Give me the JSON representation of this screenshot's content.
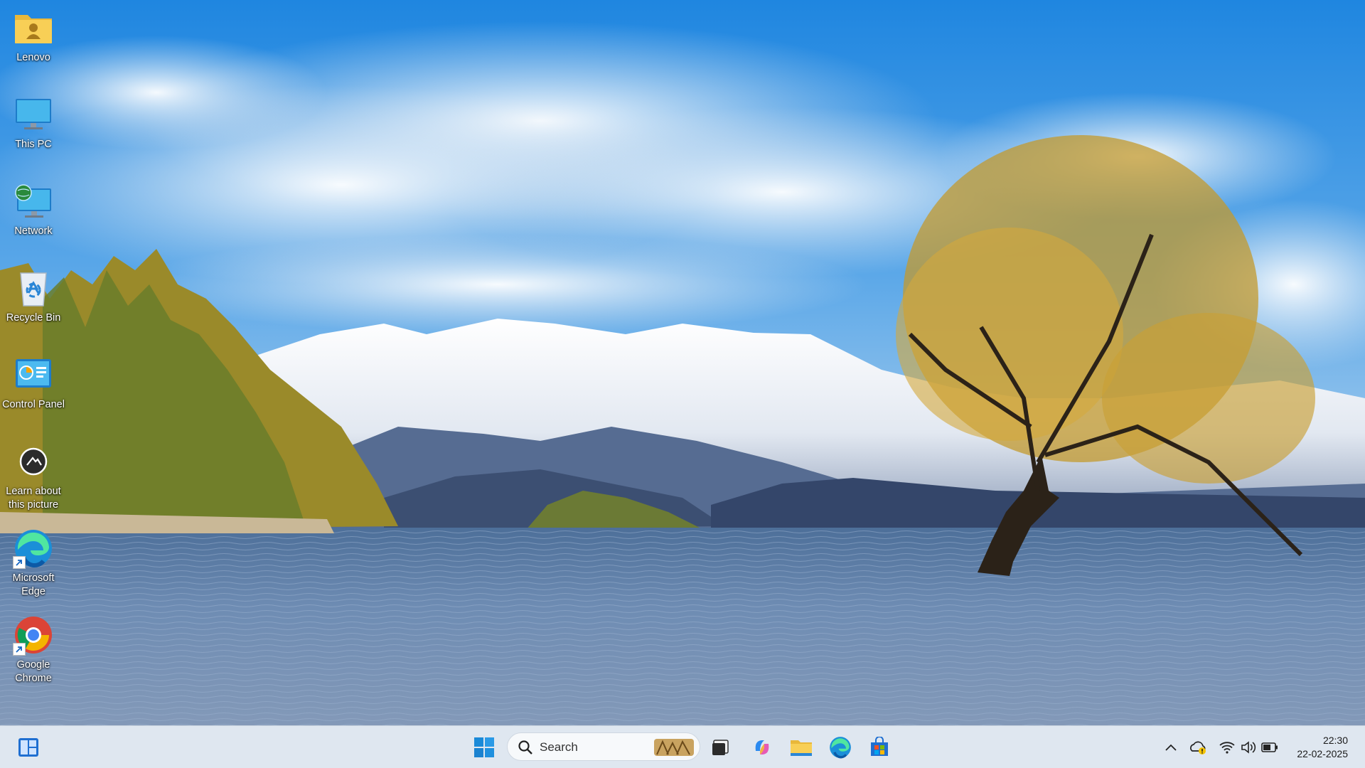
{
  "desktop": {
    "icons": [
      {
        "label": "Lenovo",
        "icon": "user-folder-icon"
      },
      {
        "label": "This PC",
        "icon": "monitor-icon"
      },
      {
        "label": "Network",
        "icon": "network-icon"
      },
      {
        "label": "Recycle Bin",
        "icon": "recycle-bin-icon"
      },
      {
        "label": "Control Panel",
        "icon": "control-panel-icon"
      },
      {
        "label": "Learn about this picture",
        "icon": "camera-icon"
      },
      {
        "label": "Microsoft Edge",
        "icon": "edge-icon"
      },
      {
        "label": "Google Chrome",
        "icon": "chrome-icon"
      }
    ]
  },
  "taskbar": {
    "search_placeholder": "Search",
    "apps": [
      "start-icon",
      "task-view-icon",
      "copilot-icon",
      "file-explorer-icon",
      "edge-icon",
      "store-icon"
    ],
    "widgets": "widgets-icon",
    "tray": [
      "chevron-up-icon",
      "onedrive-warning-icon",
      "wifi-icon",
      "volume-icon",
      "battery-icon"
    ],
    "clock": {
      "time": "22:30",
      "date": "22-02-2025"
    }
  }
}
